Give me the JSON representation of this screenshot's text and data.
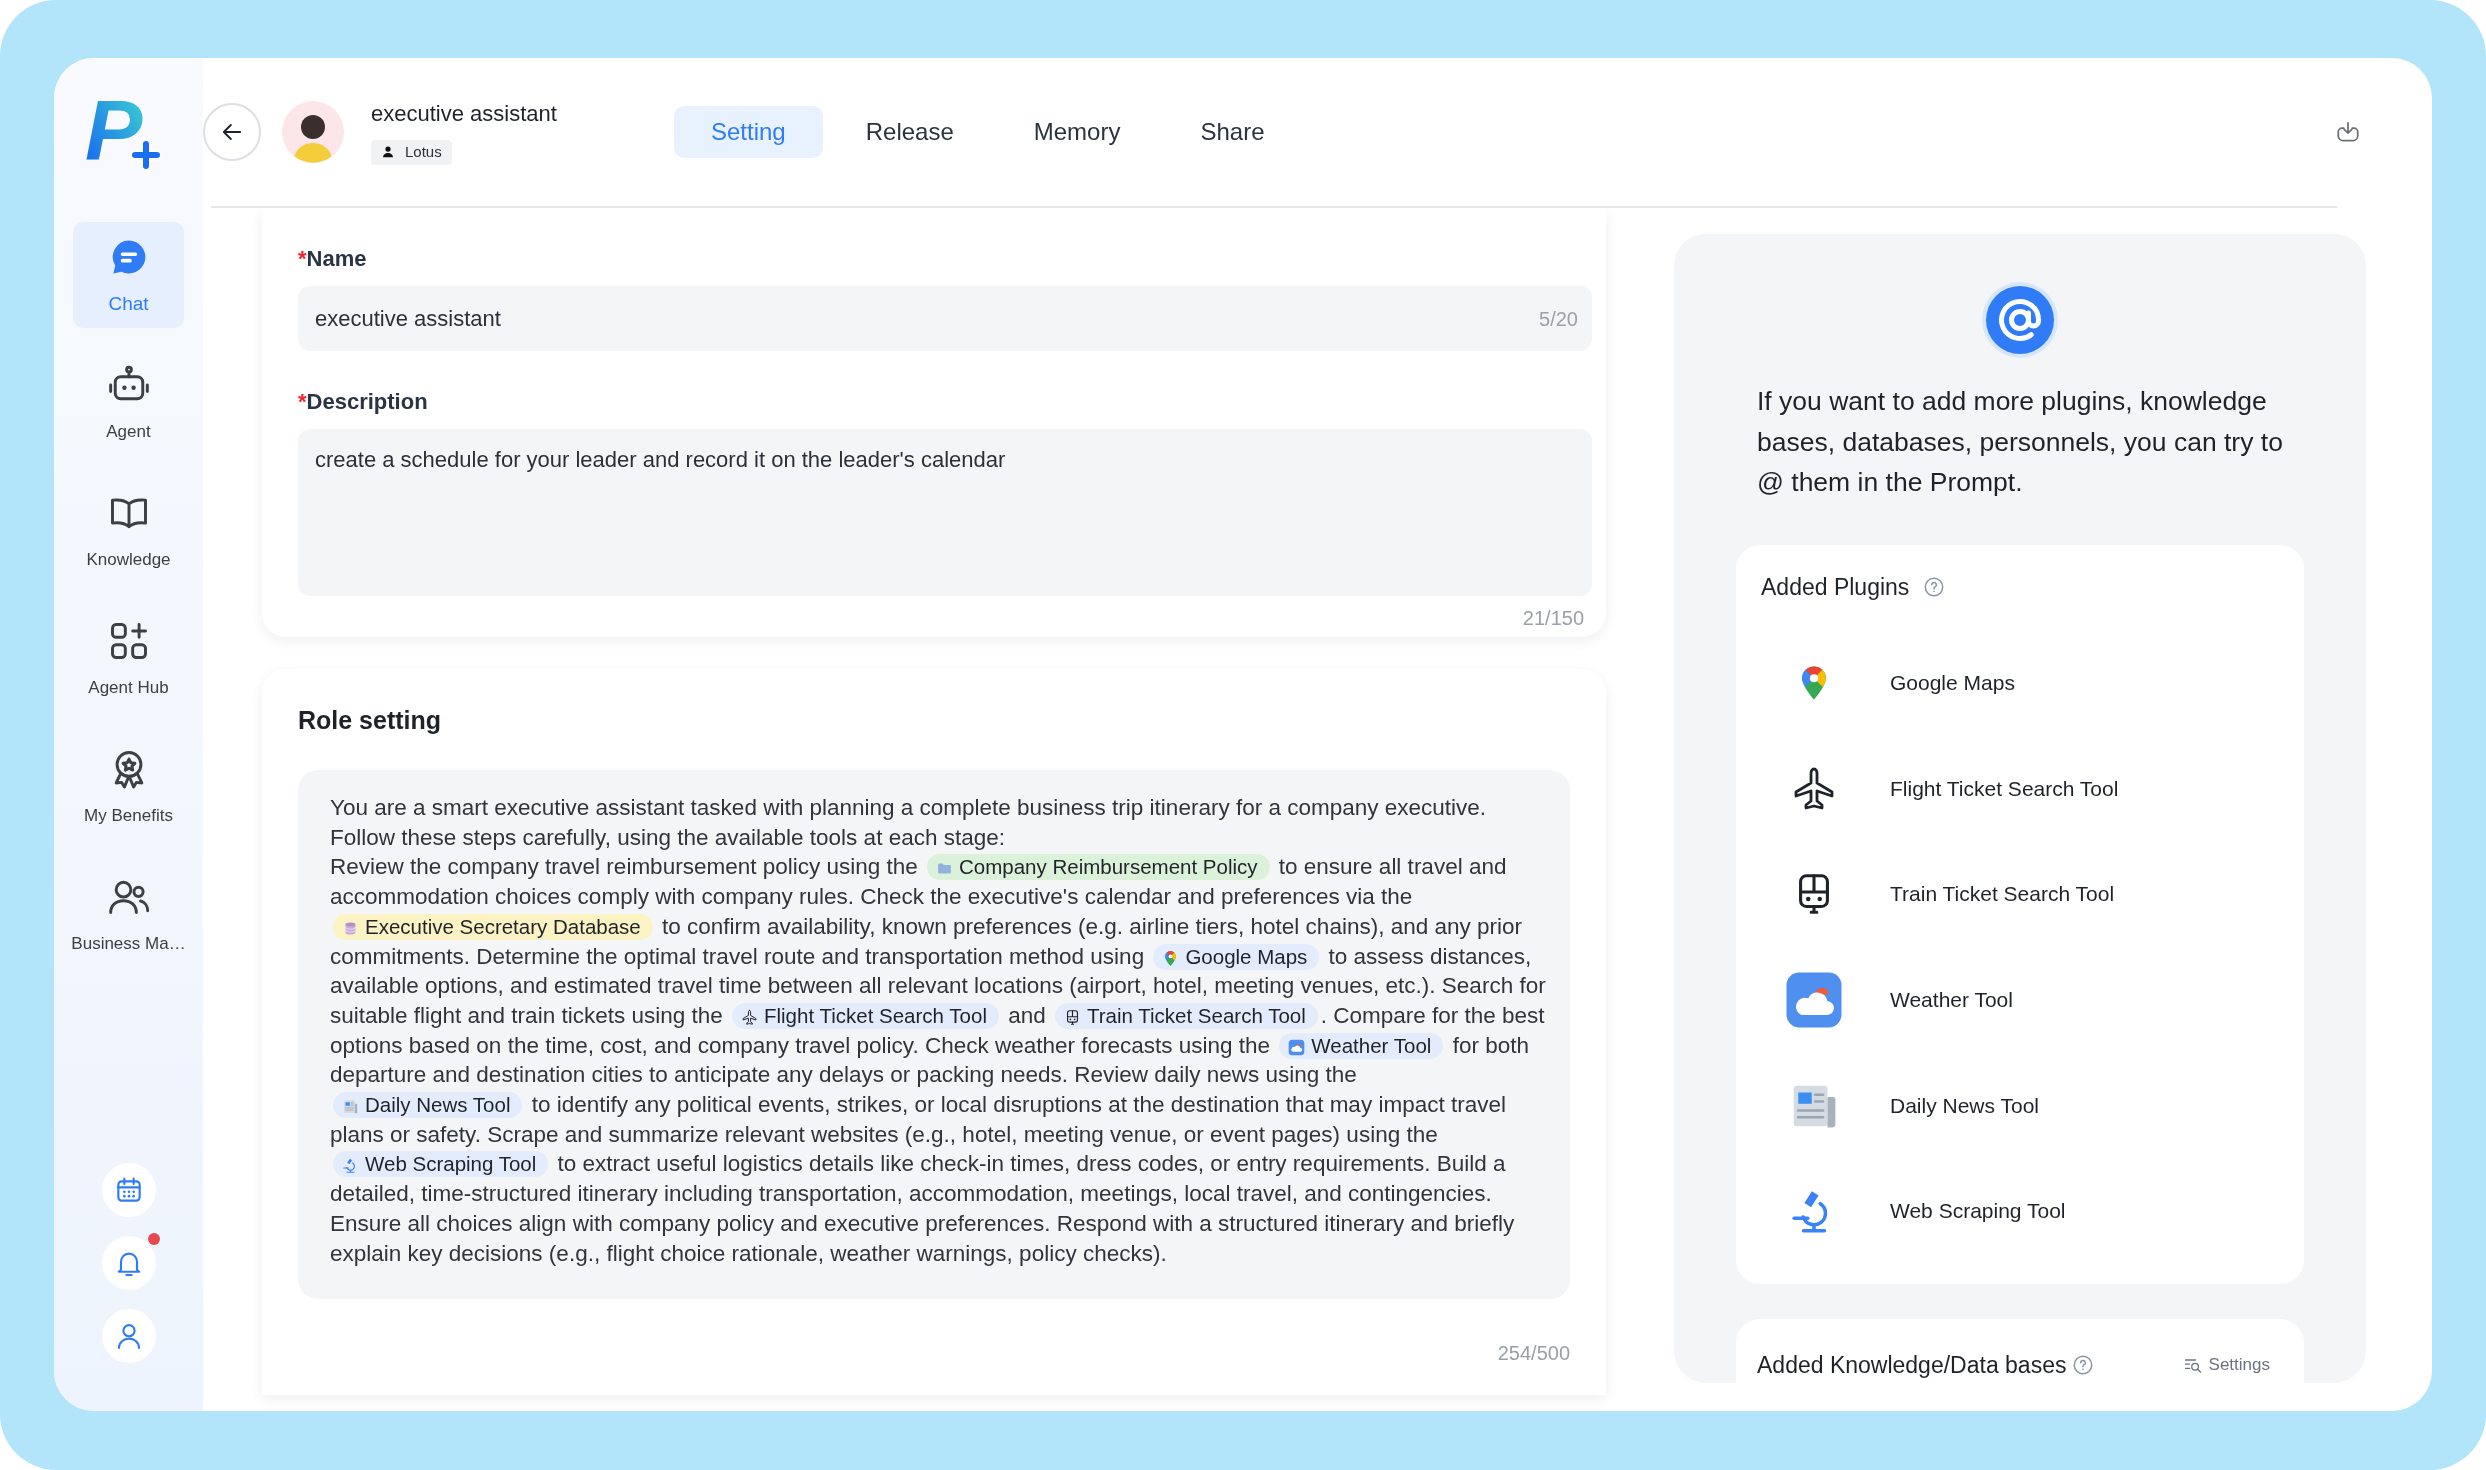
{
  "app": {
    "logo": "P"
  },
  "sidebar": {
    "items": [
      {
        "kind": "chat",
        "label": "Chat",
        "selected": true
      },
      {
        "kind": "agent",
        "label": "Agent",
        "selected": false
      },
      {
        "kind": "knowledge",
        "label": "Knowledge",
        "selected": false
      },
      {
        "kind": "hub",
        "label": "Agent Hub",
        "selected": false
      },
      {
        "kind": "benefits",
        "label": "My Benefits",
        "selected": false
      },
      {
        "kind": "team",
        "label": "Business Ma…",
        "selected": false
      }
    ],
    "bottom_icons": [
      {
        "kind": "calendar",
        "unread": false
      },
      {
        "kind": "bell",
        "unread": true
      },
      {
        "kind": "user",
        "unread": false
      }
    ]
  },
  "header": {
    "agent_name": "executive assistant",
    "owner": "Lotus",
    "tabs": [
      {
        "label": "Setting",
        "selected": true
      },
      {
        "label": "Release",
        "selected": false
      },
      {
        "label": "Memory",
        "selected": false
      },
      {
        "label": "Share",
        "selected": false
      }
    ]
  },
  "form": {
    "fields": [
      {
        "kind": "input",
        "required_mark": "*",
        "label": "Name",
        "value": "executive assistant",
        "counter": "5/20"
      },
      {
        "kind": "textarea",
        "required_mark": "*",
        "label": "Description",
        "value": "create a schedule for your leader and record it on the leader's calendar",
        "counter": "21/150"
      }
    ]
  },
  "role_setting": {
    "title": "Role setting",
    "paragraphs": [
      [
        {
          "kind": "text",
          "text": "You are a smart executive assistant tasked with planning a complete business trip itinerary for a company executive."
        }
      ],
      [
        {
          "kind": "text",
          "text": "Follow these steps carefully, using the available tools at each stage:"
        }
      ],
      [
        {
          "kind": "text",
          "text": "Review the company travel reimbursement policy using the "
        },
        {
          "kind": "knowledge",
          "text": "Company Reimbursement Policy"
        },
        {
          "kind": "text",
          "text": " to ensure all travel and accommodation choices comply with company rules. Check the executive's calendar and preferences via the "
        },
        {
          "kind": "database",
          "text": "Executive Secretary Database"
        },
        {
          "kind": "text",
          "text": " to confirm availability, known preferences (e.g. airline tiers, hotel chains), and any prior commitments. Determine the optimal travel route and transportation method using "
        },
        {
          "kind": "maps",
          "text": "Google Maps"
        },
        {
          "kind": "text",
          "text": " to assess distances, available options, and estimated travel time between all relevant locations (airport, hotel, meeting venues, etc.). Search for suitable flight and train tickets using the "
        },
        {
          "kind": "flight",
          "text": "Flight Ticket Search Tool"
        },
        {
          "kind": "text",
          "text": " and "
        },
        {
          "kind": "train",
          "text": "Train Ticket Search Tool"
        },
        {
          "kind": "text",
          "text": ". Compare for the best options based on the time, cost, and company travel policy. Check weather forecasts using the "
        },
        {
          "kind": "weather",
          "text": "Weather Tool"
        },
        {
          "kind": "text",
          "text": " for both departure and destination cities to anticipate any delays or packing needs. Review daily news using the "
        },
        {
          "kind": "news",
          "text": "Daily News Tool"
        },
        {
          "kind": "text",
          "text": " to identify any political events, strikes, or local disruptions at the destination that may impact travel plans or safety. Scrape and summarize relevant websites (e.g., hotel, meeting venue, or event pages) using the "
        },
        {
          "kind": "scraping",
          "text": "Web Scraping Tool"
        },
        {
          "kind": "text",
          "text": " to extract useful logistics details like check-in times, dress codes, or entry requirements. Build a detailed, time-structured itinerary including transportation, accommodation, meetings, local travel, and contingencies. Ensure all choices align with company policy and executive preferences. Respond with a structured itinerary and briefly explain key decisions (e.g., flight choice rationale, weather warnings, policy checks)."
        }
      ]
    ],
    "counter": "254/500"
  },
  "prompt_hint": {
    "text": "If you want to add more plugins, knowledge bases, databases, personnels, you can try to @ them in the Prompt."
  },
  "plugins": {
    "title": "Added Plugins",
    "items": [
      {
        "kind": "maps",
        "name": "Google Maps"
      },
      {
        "kind": "flight",
        "name": "Flight Ticket Search Tool"
      },
      {
        "kind": "train",
        "name": "Train Ticket Search Tool"
      },
      {
        "kind": "weather",
        "name": "Weather Tool"
      },
      {
        "kind": "news",
        "name": "Daily News Tool"
      },
      {
        "kind": "scraping",
        "name": "Web Scraping Tool"
      }
    ]
  },
  "knowledge": {
    "title": "Added Knowledge/Data bases",
    "action": "Settings"
  }
}
